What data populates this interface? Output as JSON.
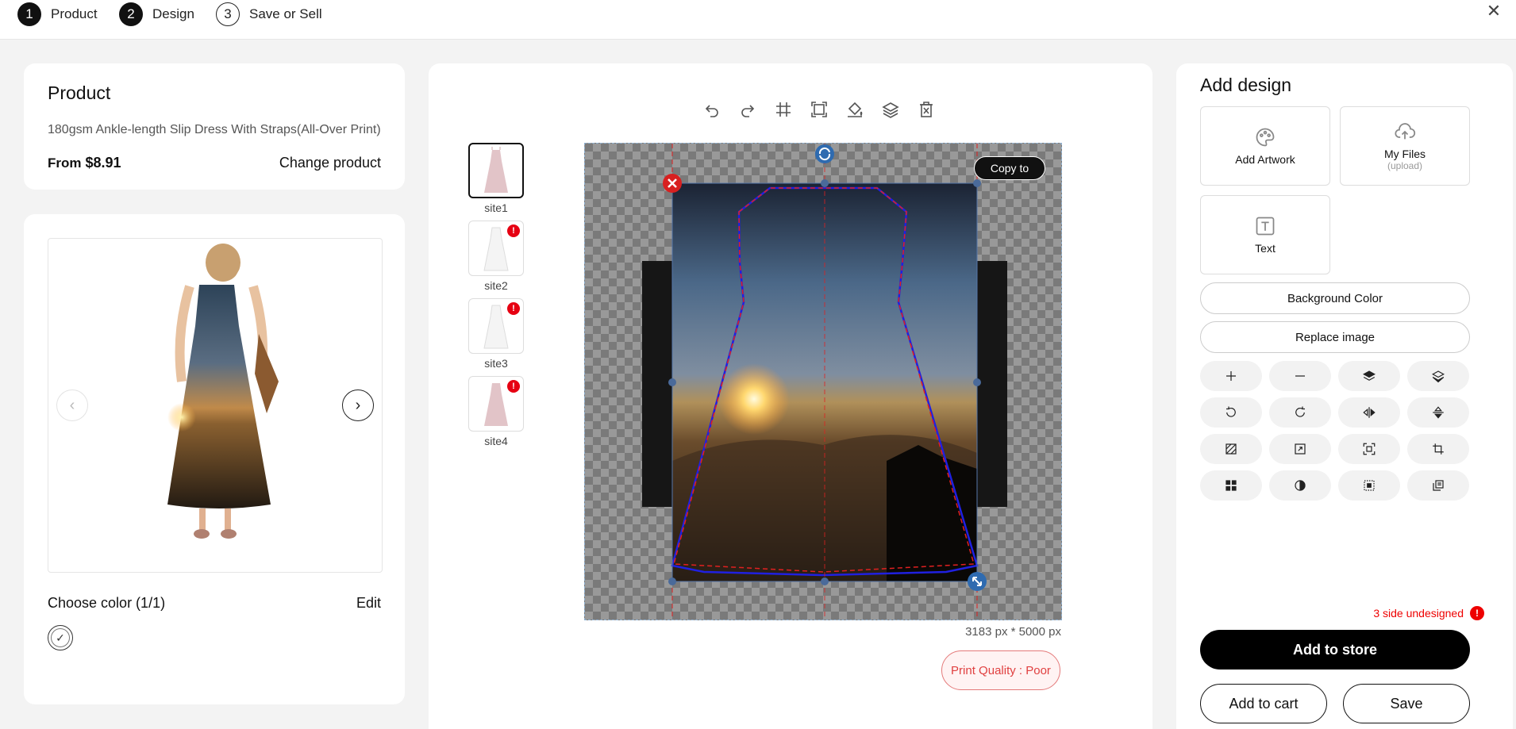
{
  "steps": [
    {
      "num": "1",
      "label": "Product"
    },
    {
      "num": "2",
      "label": "Design"
    },
    {
      "num": "3",
      "label": "Save or Sell"
    }
  ],
  "close_glyph": "✕",
  "product": {
    "title": "Product",
    "name": "180gsm Ankle-length Slip Dress With Straps(All-Over Print)",
    "price_prefix": "From",
    "price": "$8.91",
    "change_label": "Change product"
  },
  "preview": {
    "prev_glyph": "‹",
    "next_glyph": "›",
    "choose_color": "Choose color  (1/1)",
    "edit_label": "Edit",
    "check_glyph": "✓"
  },
  "toolbar_icons": [
    "undo-icon",
    "redo-icon",
    "grid-icon",
    "fit-screen-icon",
    "fill-icon",
    "layers-icon",
    "delete-icon"
  ],
  "sites": [
    {
      "label": "site1",
      "warn": false,
      "active": true
    },
    {
      "label": "site2",
      "warn": true,
      "active": false
    },
    {
      "label": "site3",
      "warn": true,
      "active": false
    },
    {
      "label": "site4",
      "warn": true,
      "active": false
    }
  ],
  "warn_glyph": "!",
  "canvas": {
    "copy_to": "Copy to",
    "dimensions": "3183 px * 5000 px",
    "quality": "Print Quality : Poor"
  },
  "right": {
    "title": "Add design",
    "add_artwork": "Add Artwork",
    "my_files": "My Files",
    "my_files_sub": "(upload)",
    "text": "Text",
    "background_color": "Background Color",
    "replace_image": "Replace image",
    "tools": [
      "zoom-in-icon",
      "zoom-out-icon",
      "bring-forward-icon",
      "send-backward-icon",
      "rotate-left-icon",
      "rotate-right-icon",
      "flip-horizontal-icon",
      "flip-vertical-icon",
      "pattern-icon",
      "expand-icon",
      "fit-icon",
      "crop-icon",
      "align-center-icon",
      "contrast-icon",
      "transparency-icon",
      "duplicate-icon"
    ],
    "undesigned": "3 side undesigned",
    "add_to_store": "Add to store",
    "add_to_cart": "Add to cart",
    "save": "Save"
  },
  "colors": {
    "accent": "#000000",
    "warning": "#e60012",
    "outline_blue": "#2020e0",
    "guide_red": "#e02020"
  }
}
